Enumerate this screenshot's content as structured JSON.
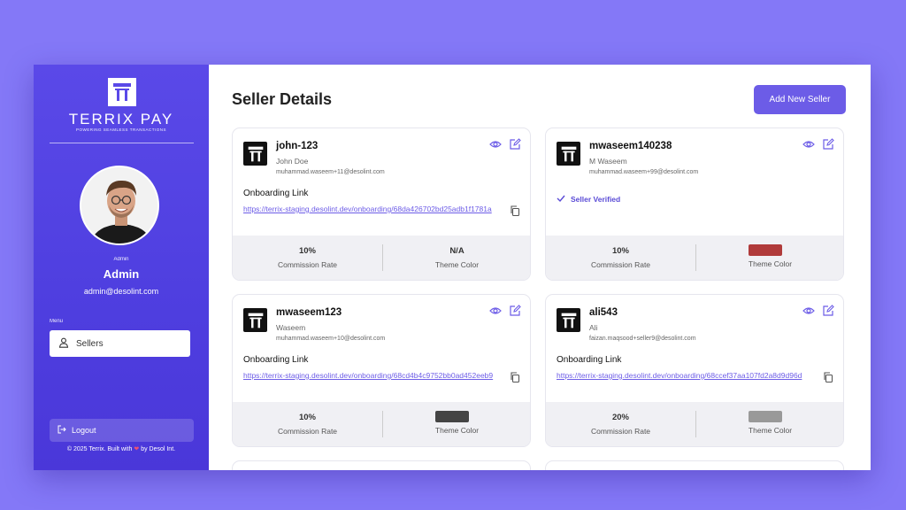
{
  "brand": {
    "name": "TERRIX PAY",
    "tagline": "POWERING SEAMLESS TRANSACTIONS",
    "logo": "tt-logo-icon"
  },
  "user": {
    "role": "Admin",
    "name": "Admin",
    "email": "admin@desolint.com"
  },
  "menu": {
    "label": "Menu",
    "items": [
      {
        "label": "Sellers",
        "icon": "user-icon"
      }
    ]
  },
  "logout_label": "Logout",
  "footer": {
    "before": "© 2025 Terrix. Built with",
    "after": "by Desol Int."
  },
  "page": {
    "title": "Seller Details",
    "add_button": "Add New Seller"
  },
  "labels": {
    "onboarding": "Onboarding Link",
    "commission": "Commission Rate",
    "theme": "Theme Color",
    "verified": "Seller Verified"
  },
  "sellers": [
    {
      "username": "john-123",
      "name": "John Doe",
      "email": "muhammad.waseem+11@desolint.com",
      "link": "https://terrix-staging.desolint.dev/onboarding/68da426702bd25adb1f1781a",
      "commission": "10%",
      "theme_value": "N/A"
    },
    {
      "username": "mwaseem140238",
      "name": "M Waseem",
      "email": "muhammad.waseem+99@desolint.com",
      "commission": "10%",
      "theme_color": "#b03a3a"
    },
    {
      "username": "mwaseem123",
      "name": "Waseem",
      "email": "muhammad.waseem+10@desolint.com",
      "link": "https://terrix-staging.desolint.dev/onboarding/68cd4b4c9752bb0ad452eeb9",
      "commission": "10%",
      "theme_color": "#444444"
    },
    {
      "username": "ali543",
      "name": "Ali",
      "email": "faizan.maqsood+seller9@desolint.com",
      "link": "https://terrix-staging.desolint.dev/onboarding/68ccef37aa107fd2a8d9d96d",
      "commission": "20%",
      "theme_color": "#999999"
    }
  ],
  "colors": {
    "accent": "#6c5ce7",
    "sidebar": "#4f3fe0",
    "background": "#8478f7"
  }
}
